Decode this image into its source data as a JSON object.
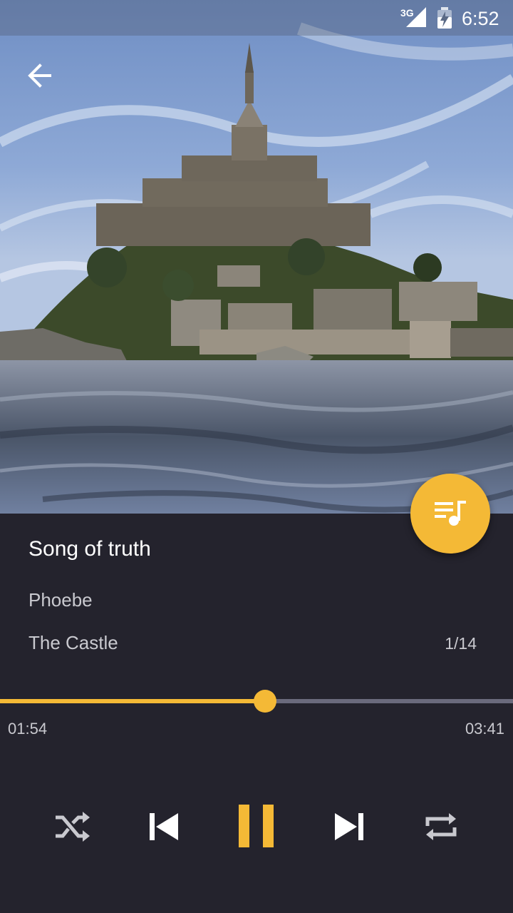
{
  "status_bar": {
    "network": "3G",
    "time": "6:52"
  },
  "album_art": {
    "subject": "castle-on-island-over-water"
  },
  "header": {
    "back_icon": "arrow-left-icon"
  },
  "fab": {
    "icon": "playlist-music-icon",
    "color": "#f4b936"
  },
  "track": {
    "title": "Song of truth",
    "artist": "Phoebe",
    "album": "The Castle",
    "position_in_queue": "1/14"
  },
  "progress": {
    "elapsed": "01:54",
    "total": "03:41",
    "fraction": 0.516
  },
  "controls": {
    "shuffle_icon": "shuffle-icon",
    "previous_icon": "skip-previous-icon",
    "pause_icon": "pause-icon",
    "next_icon": "skip-next-icon",
    "repeat_icon": "repeat-icon"
  },
  "colors": {
    "accent": "#f4b936",
    "background": "#24232d",
    "text_primary": "#ffffff",
    "text_secondary": "#c9c9cf",
    "track_inactive": "#6a6a7c"
  }
}
